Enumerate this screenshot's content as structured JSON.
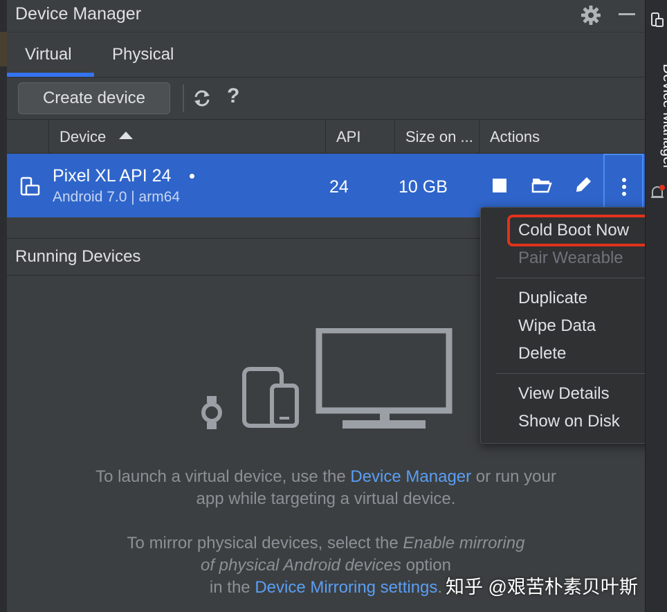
{
  "window": {
    "title": "Device Manager",
    "icons": {
      "settings": "gear-icon",
      "minimize": "minimize-icon"
    }
  },
  "tabs": [
    {
      "label": "Virtual",
      "selected": true
    },
    {
      "label": "Physical",
      "selected": false
    }
  ],
  "toolbar": {
    "create_label": "Create device",
    "refresh_icon": "refresh-icon",
    "help_label": "?"
  },
  "table": {
    "columns": [
      "Device",
      "API",
      "Size on ...",
      "Actions"
    ],
    "sort_column": "Device",
    "rows": [
      {
        "name": "Pixel XL API 24",
        "subtitle": "Android 7.0 | arm64",
        "api": "24",
        "size": "10 GB",
        "selected": true,
        "actions": [
          "stop-icon",
          "folder-icon",
          "edit-icon",
          "more-icon"
        ]
      }
    ]
  },
  "running": {
    "title": "Running Devices",
    "msg1_a": "To launch a virtual device, use the ",
    "msg1_link": "Device Manager",
    "msg1_b": " or run your",
    "msg1_c": "app while targeting a virtual device.",
    "msg2_a": "To mirror physical devices, select the ",
    "msg2_em1": "Enable mirroring",
    "msg2_em2": "of physical Android devices",
    "msg2_b": " option",
    "msg2_c": "in the ",
    "msg2_link": "Device Mirroring settings",
    "msg2_d": "."
  },
  "context_menu": {
    "items": [
      {
        "label": "Cold Boot Now",
        "enabled": true,
        "highlighted": true
      },
      {
        "label": "Pair Wearable",
        "enabled": false
      },
      {
        "label": "Duplicate",
        "enabled": true
      },
      {
        "label": "Wipe Data",
        "enabled": true
      },
      {
        "label": "Delete",
        "enabled": true
      },
      {
        "label": "View Details",
        "enabled": true
      },
      {
        "label": "Show on Disk",
        "enabled": true
      }
    ]
  },
  "side_panel": {
    "label": "Device Manager"
  },
  "watermark": "知乎 @艰苦朴素贝叶斯",
  "colors": {
    "accent": "#3574f0",
    "selected_row": "#2f65ca",
    "link": "#5a9ef5",
    "highlight": "#e0331b"
  }
}
